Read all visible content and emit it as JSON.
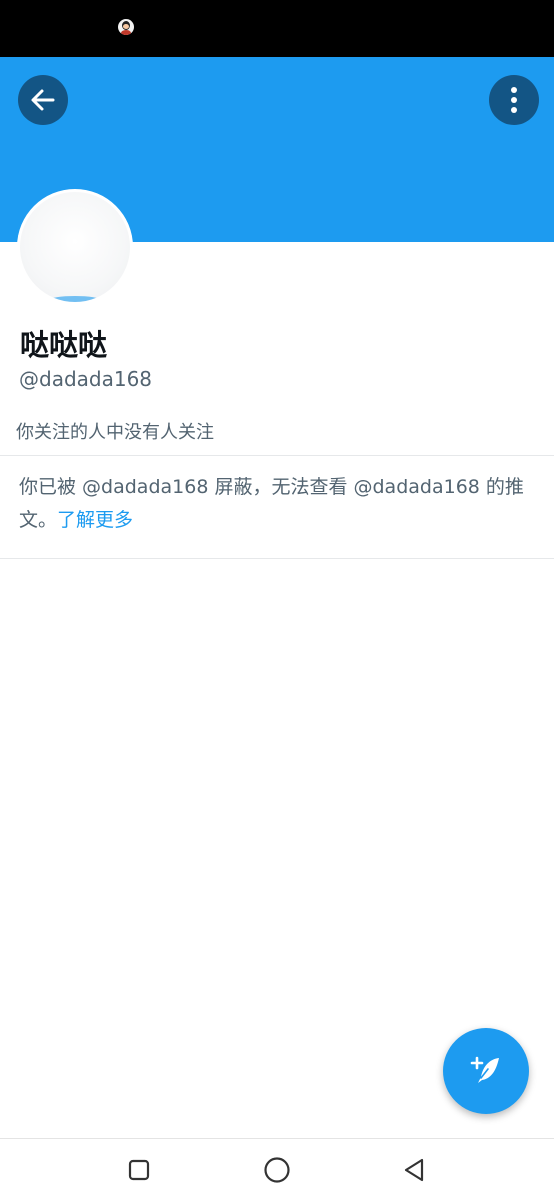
{
  "status_bar": {
    "notification_icon": "avatar-notification-icon"
  },
  "header": {
    "back_icon": "arrow-left-icon",
    "more_icon": "more-vertical-icon",
    "banner_color": "#1d9bf0"
  },
  "profile": {
    "display_name": "哒哒哒",
    "handle": "@dadada168",
    "followers_you_know": "你关注的人中没有人关注"
  },
  "blocked_notice": {
    "message": "你已被 @dadada168 屏蔽，无法查看 @dadada168 的推文。",
    "learn_more": "了解更多"
  },
  "fab": {
    "icon": "compose-tweet-icon"
  },
  "system_nav": {
    "recents_icon": "square-recents-icon",
    "home_icon": "circle-home-icon",
    "back_icon": "triangle-back-icon"
  },
  "colors": {
    "accent": "#1d9bf0",
    "text_primary": "#0f1419",
    "text_secondary": "#536471"
  }
}
